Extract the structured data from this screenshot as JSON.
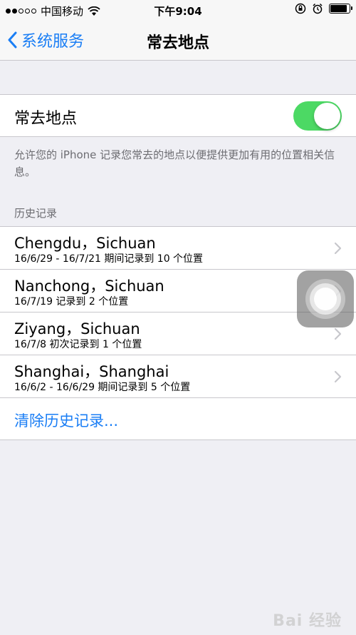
{
  "status_bar": {
    "carrier": "中国移动",
    "time": "下午9:04"
  },
  "nav": {
    "back_label": "系统服务",
    "title": "常去地点"
  },
  "toggle": {
    "label": "常去地点",
    "on": true,
    "color": "#4cd964"
  },
  "footer": {
    "text": "允许您的 iPhone 记录您常去的地点以便提供更加有用的位置相关信息。"
  },
  "history": {
    "header": "历史记录",
    "items": [
      {
        "title": "Chengdu，Sichuan",
        "subtitle": "16/6/29 - 16/7/21 期间记录到 10 个位置"
      },
      {
        "title": "Nanchong，Sichuan",
        "subtitle": "16/7/19 记录到 2 个位置"
      },
      {
        "title": "Ziyang，Sichuan",
        "subtitle": "16/7/8 初次记录到 1 个位置"
      },
      {
        "title": "Shanghai，Shanghai",
        "subtitle": "16/6/2 - 16/6/29 期间记录到 5 个位置"
      }
    ],
    "clear_label": "清除历史记录..."
  },
  "watermark": "Bai 经验",
  "colors": {
    "accent": "#1a7ef5",
    "background": "#efeff4",
    "toggle_on": "#4cd964"
  }
}
